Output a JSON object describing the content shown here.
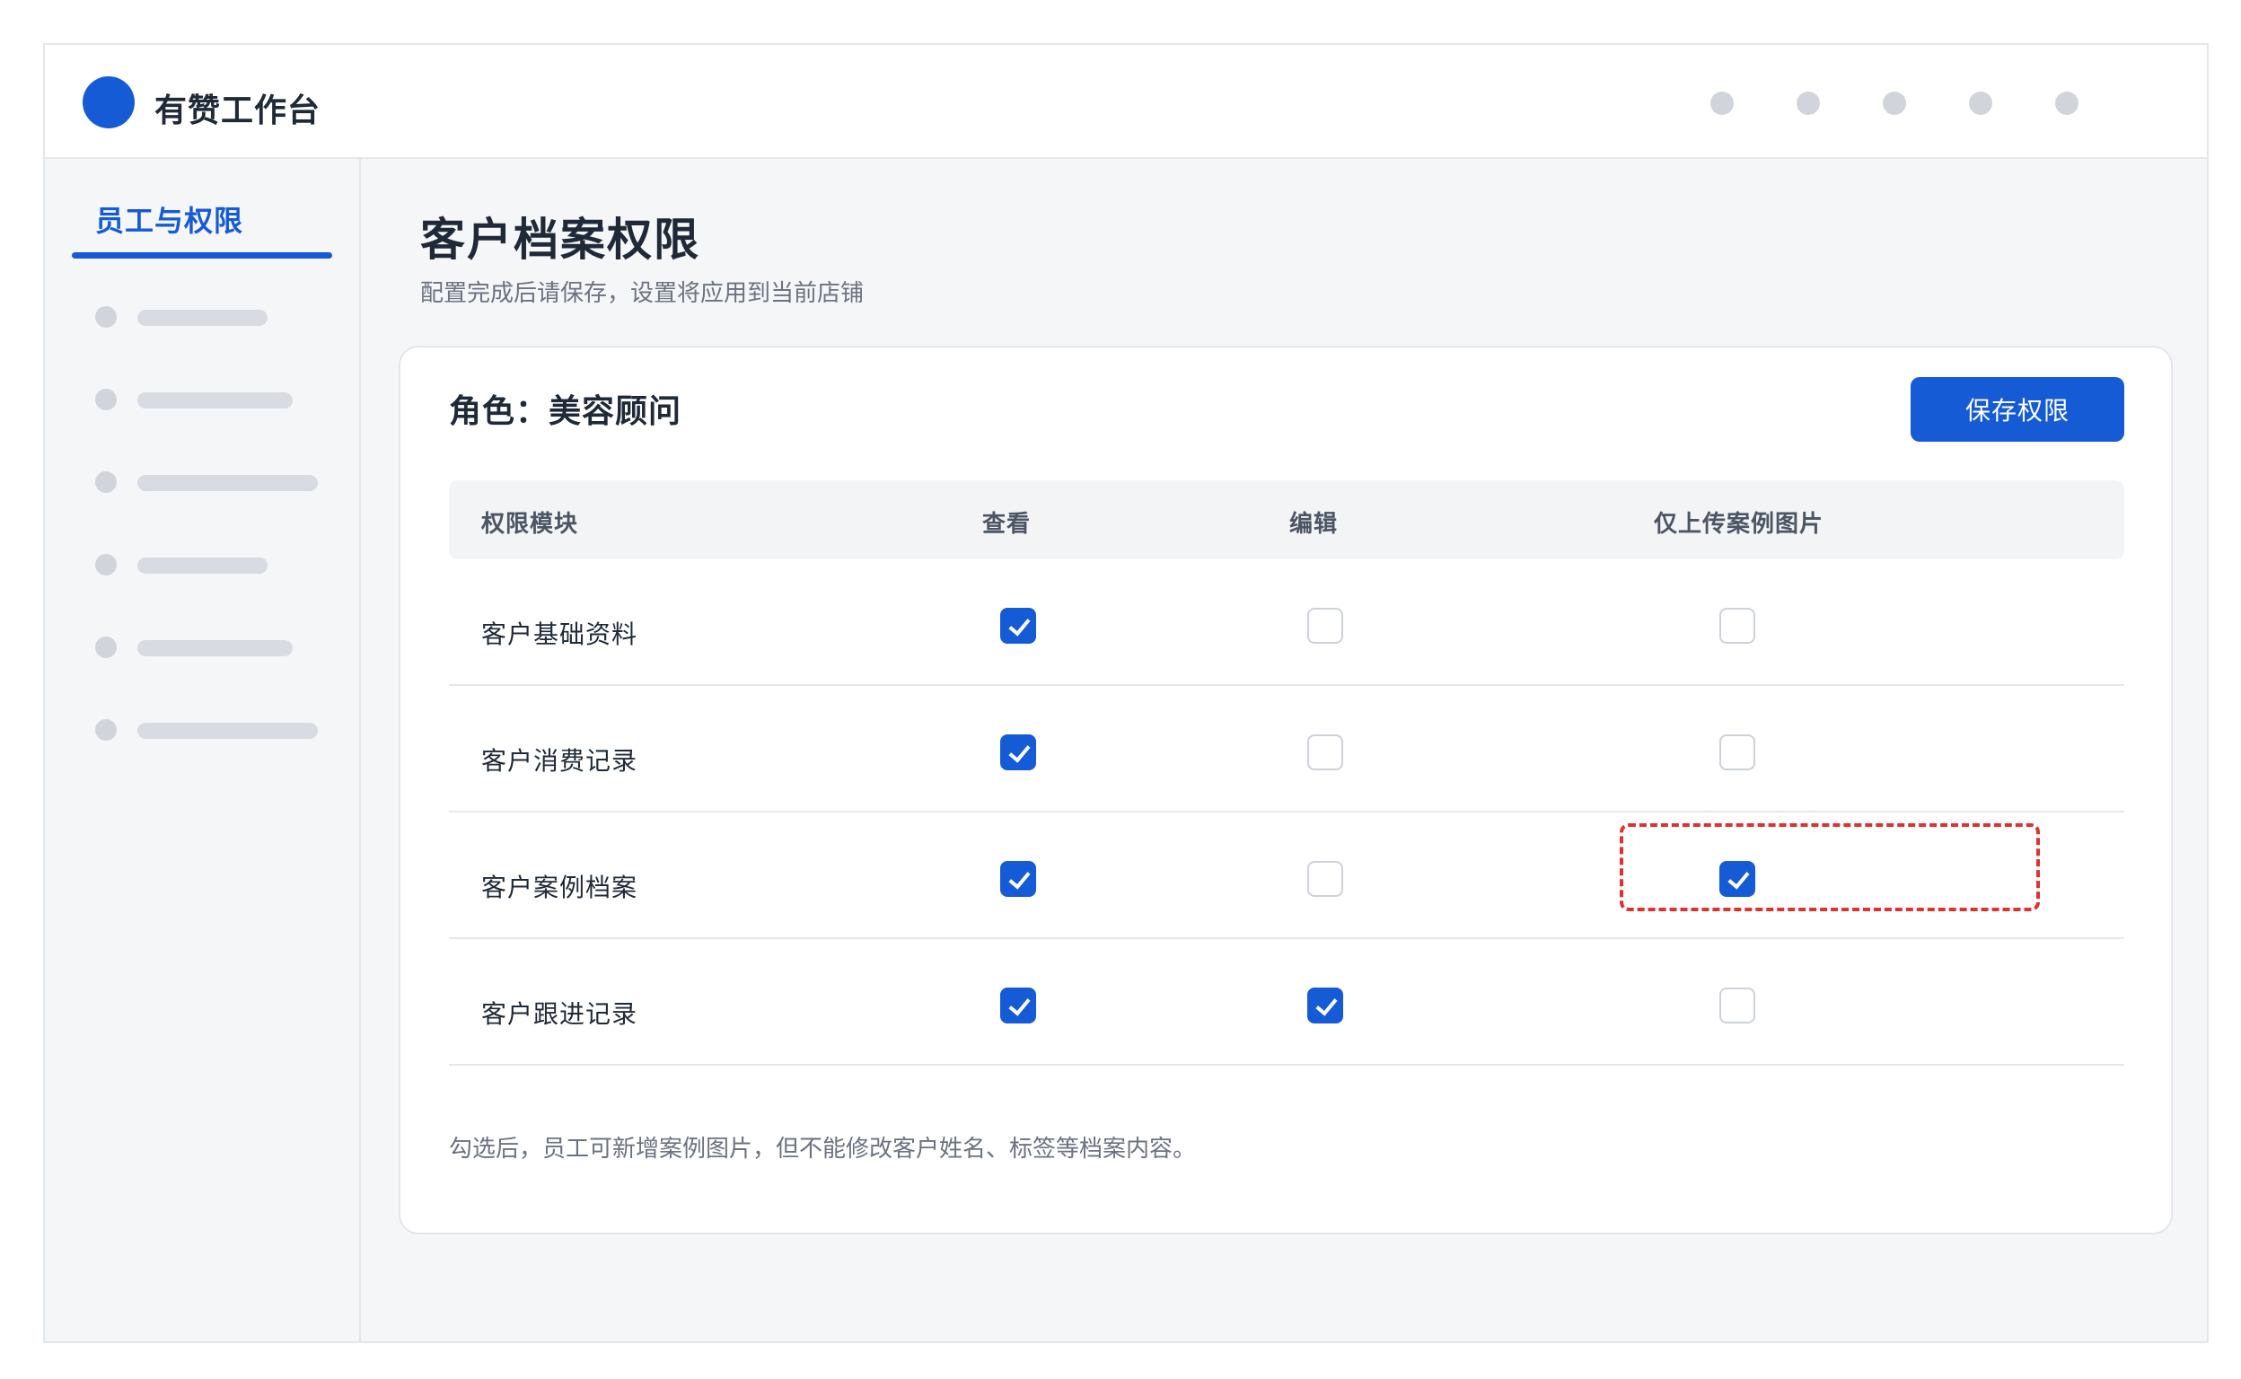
{
  "app": {
    "title": "有赞工作台"
  },
  "topbar": {
    "icons": [
      "dot-icon",
      "dot-icon",
      "dot-icon",
      "dot-icon",
      "dot-icon"
    ]
  },
  "sidebar": {
    "active_label": "员工与权限",
    "placeholder_count": 6
  },
  "page": {
    "title": "客户档案权限",
    "subtitle": "配置完成后请保存，设置将应用到当前店铺"
  },
  "card": {
    "role_title": "角色：美容顾问",
    "save_label": "保存权限",
    "note": "勾选后，员工可新增案例图片，但不能修改客户姓名、标签等档案内容。"
  },
  "table": {
    "headers": [
      "权限模块",
      "查看",
      "编辑",
      "仅上传案例图片"
    ],
    "rows": [
      {
        "label": "客户基础资料",
        "view": true,
        "edit": false,
        "upload": false
      },
      {
        "label": "客户消费记录",
        "view": true,
        "edit": false,
        "upload": false
      },
      {
        "label": "客户案例档案",
        "view": true,
        "edit": false,
        "upload": true,
        "highlight": true
      },
      {
        "label": "客户跟进记录",
        "view": true,
        "edit": true,
        "upload": false
      }
    ]
  },
  "colors": {
    "primary": "#155bd5",
    "highlight_border": "#e03131",
    "background": "#f5f6f8"
  }
}
